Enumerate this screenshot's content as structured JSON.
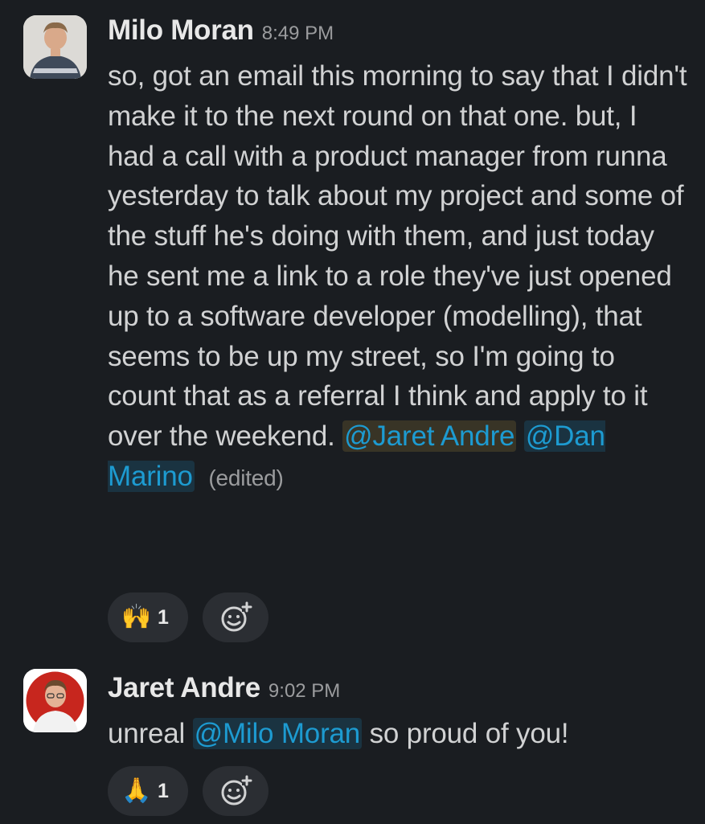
{
  "messages": [
    {
      "author": "Milo Moran",
      "time": "8:49 PM",
      "body": "so, got an email this morning to say that I didn't make it to the next round on that one. but, I had a call with a product manager from runna yesterday to talk about my project and some of the stuff he's doing with them, and just today he sent me a link to a role they've just opened up to a software developer (modelling), that seems to be up my street, so I'm going to count that as a referral I think and apply to it over the weekend.",
      "mentions": [
        "@Jaret Andre",
        "@Dan Marino"
      ],
      "edited_label": "(edited)",
      "reactions": [
        {
          "emoji": "🙌",
          "emoji_name": "raised-hands",
          "count": "1"
        }
      ],
      "add_reaction_icon": "add-reaction-icon"
    },
    {
      "author": "Jaret Andre",
      "time": "9:02 PM",
      "body_before": "unreal",
      "mention": "@Milo Moran",
      "body_after": "so proud of you!",
      "reactions": [
        {
          "emoji": "🙏",
          "emoji_name": "folded-hands",
          "count": "1"
        }
      ],
      "add_reaction_icon": "add-reaction-icon"
    }
  ],
  "colors": {
    "background": "#1a1d21",
    "text": "#d1d2d3",
    "mention": "#1d9bd1",
    "reaction_pill": "#2b2e33"
  }
}
